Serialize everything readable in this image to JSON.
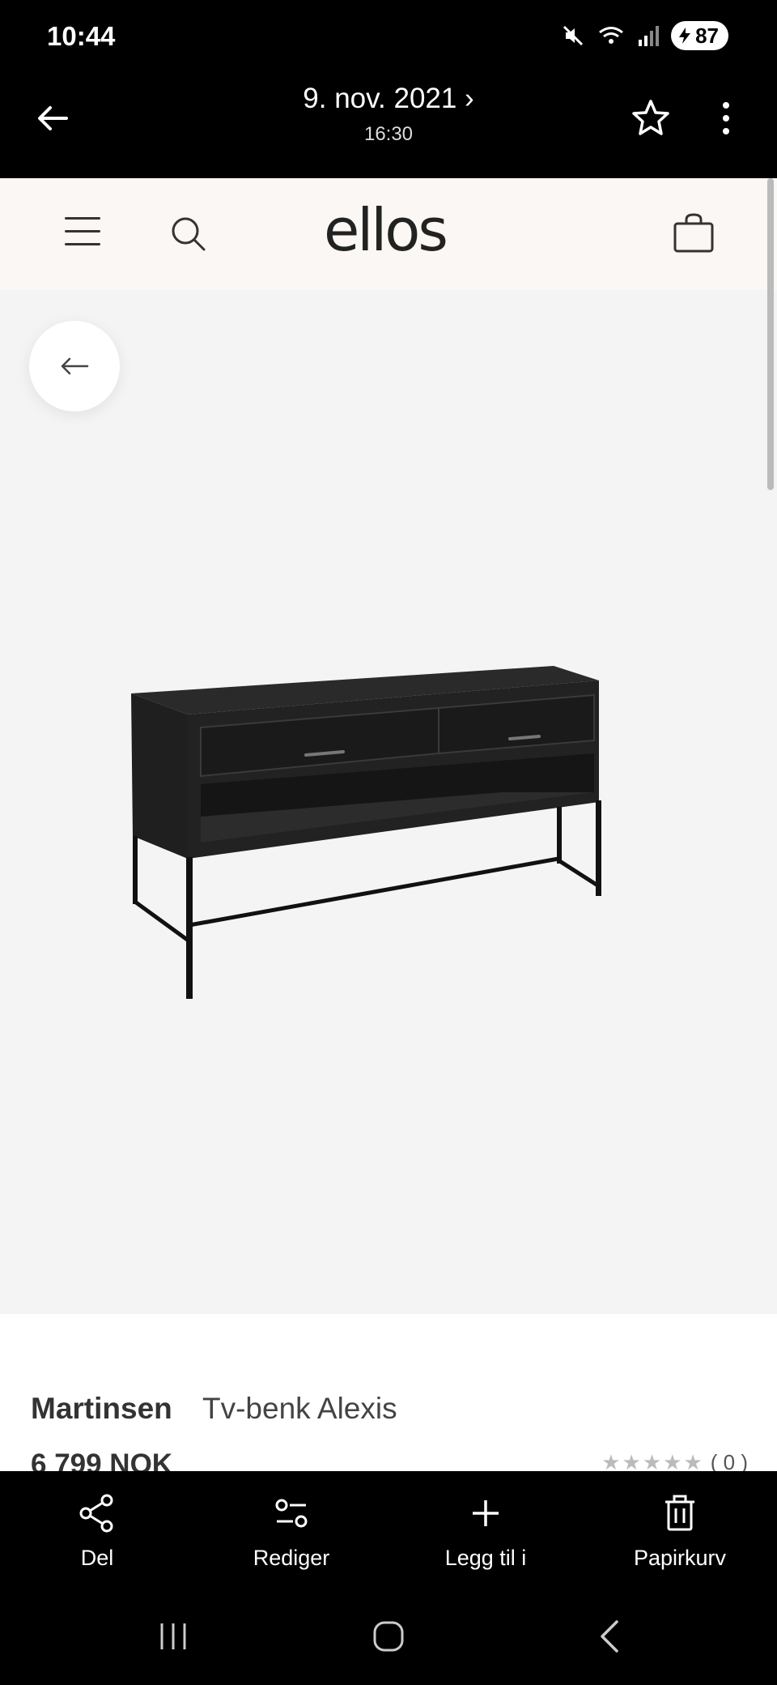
{
  "status_bar": {
    "time": "10:44",
    "battery": "87",
    "icons": [
      "mute-icon",
      "wifi-icon",
      "signal-icon",
      "battery-icon"
    ]
  },
  "gallery_header": {
    "date": "9. nov. 2021 ›",
    "time": "16:30",
    "icons": [
      "back-arrow-icon",
      "star-icon",
      "more-vertical-icon"
    ]
  },
  "site": {
    "logo": "ellos",
    "icons": [
      "hamburger-menu-icon",
      "search-icon",
      "shopping-bag-icon"
    ]
  },
  "product": {
    "brand": "Martinsen",
    "name": "Tv-benk Alexis",
    "price": "6 799 NOK",
    "stars": "★★★★★",
    "rating_count": "( 0 )",
    "rating_value": 0,
    "image": "black-tv-bench-with-two-drawers-and-metal-legs"
  },
  "actions": [
    {
      "label": "Del",
      "icon": "share-icon"
    },
    {
      "label": "Rediger",
      "icon": "edit-sliders-icon"
    },
    {
      "label": "Legg til i",
      "icon": "plus-icon"
    },
    {
      "label": "Papirkurv",
      "icon": "trash-icon"
    }
  ],
  "nav_bar": {
    "icons": [
      "recent-apps-icon",
      "home-icon",
      "back-icon"
    ]
  },
  "colors": {
    "header_bg": "#faf7f4",
    "image_bg": "#f4f4f4",
    "system_bg": "#000000"
  }
}
